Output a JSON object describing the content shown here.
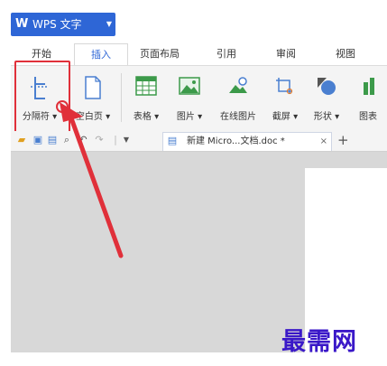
{
  "app": {
    "title": "WPS 文字",
    "logo_letter": "W"
  },
  "tabs": [
    {
      "label": "开始"
    },
    {
      "label": "插入"
    },
    {
      "label": "页面布局"
    },
    {
      "label": "引用"
    },
    {
      "label": "审阅"
    },
    {
      "label": "视图"
    }
  ],
  "active_tab": "插入",
  "ribbon": {
    "page_break": "分隔符",
    "blank_page": "空白页",
    "table": "表格",
    "picture": "图片",
    "online_picture": "在线图片",
    "screenshot": "截屏",
    "shape": "形状",
    "chart": "图表"
  },
  "document_tab": {
    "name": "新建 Micro...文档.doc *",
    "close": "×"
  },
  "new_tab": "+",
  "watermark": "最需网",
  "colors": {
    "accent": "#2e66d6",
    "highlight": "#e0303a",
    "watermark": "#3a18c8"
  }
}
